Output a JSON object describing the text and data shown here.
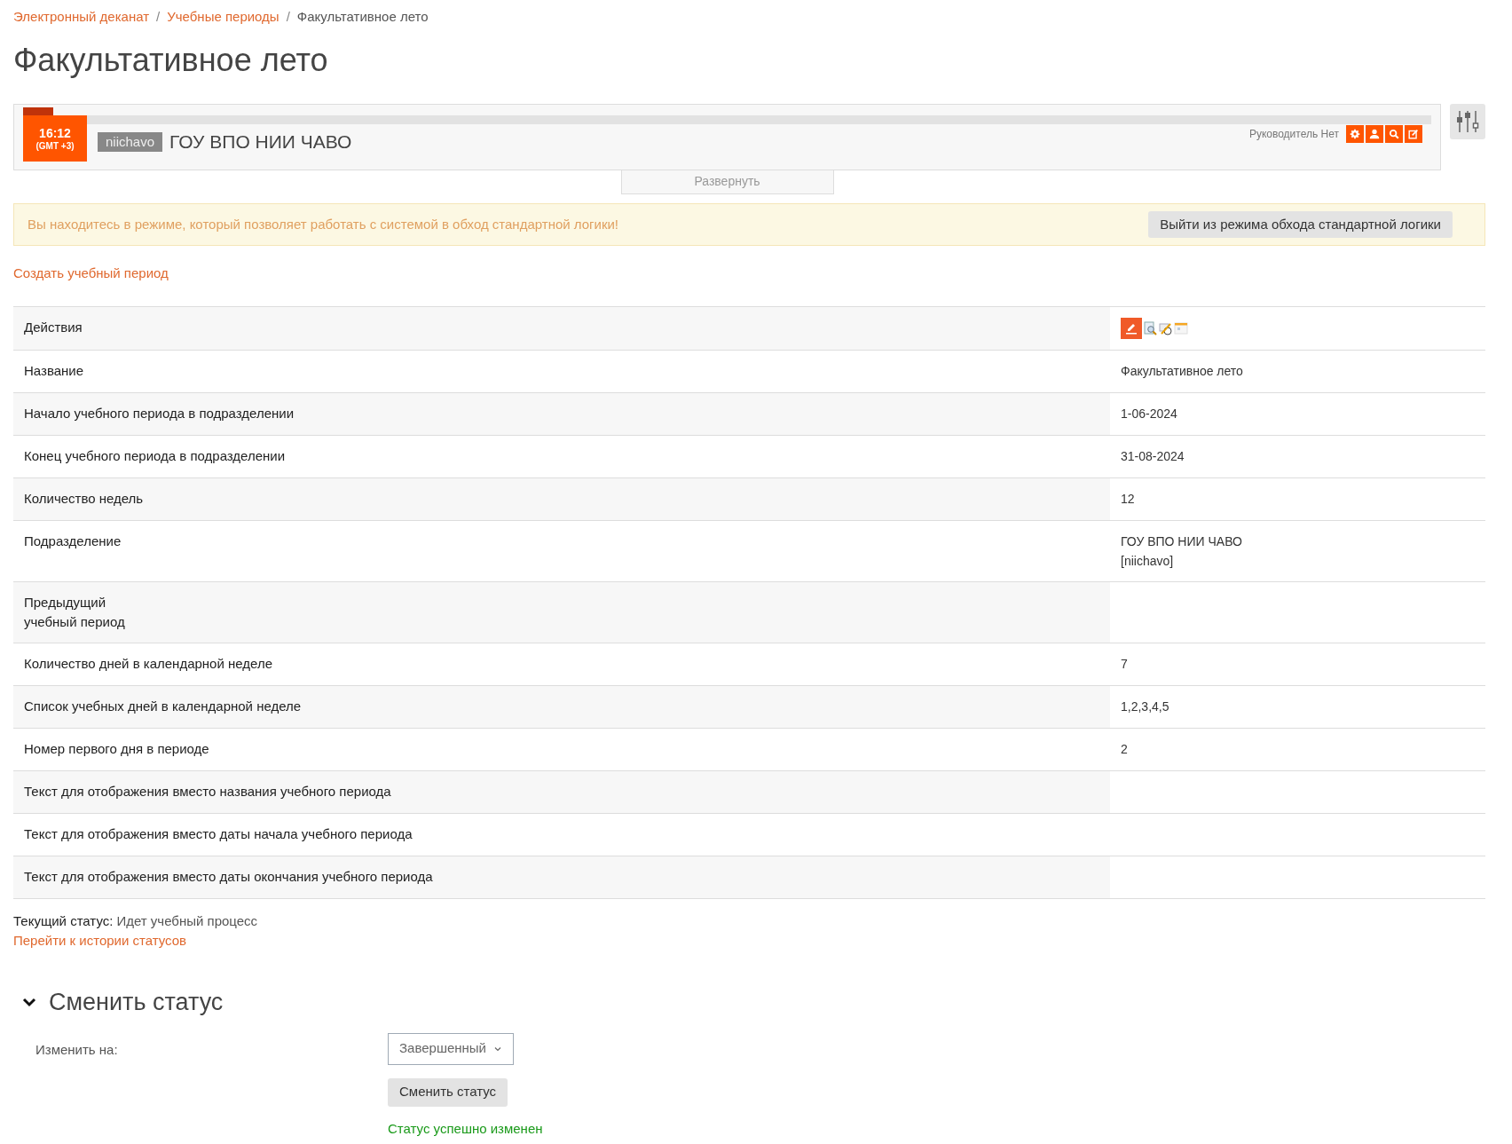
{
  "breadcrumb": [
    {
      "label": "Электронный деканат",
      "current": false
    },
    {
      "separator": "/"
    },
    {
      "label": "Учебные периоды",
      "current": false
    },
    {
      "separator": "/"
    },
    {
      "label": "Факультативное лето",
      "current": true
    }
  ],
  "title": "Факультативное лето",
  "header": {
    "clock_time": "16:12",
    "clock_zone": "(GMT +3)",
    "code": "niichavo",
    "org_name": "ГОУ ВПО НИИ ЧАВО",
    "manager_label": "Руководитель Нет",
    "expand_label": "Развернуть"
  },
  "alert": {
    "text": "Вы находитесь в режиме, который позволяет работать с системой в обход стандартной логики!",
    "button": "Выйти из режима обхода стандартной логики"
  },
  "create_link": "Создать учебный период",
  "table": {
    "rows": [
      {
        "kind": "actions",
        "label": "Действия"
      },
      {
        "kind": "text",
        "label": "Название",
        "value": [
          "Факультативное лето"
        ]
      },
      {
        "kind": "text",
        "label": "Начало учебного периода в подразделении",
        "value": [
          "1-06-2024"
        ]
      },
      {
        "kind": "text",
        "label": "Конец учебного периода в подразделении",
        "value": [
          "31-08-2024"
        ]
      },
      {
        "kind": "text",
        "label": "Количество недель",
        "value": [
          "12"
        ]
      },
      {
        "kind": "text",
        "label": "Подразделение",
        "value": [
          "ГОУ ВПО НИИ ЧАВО",
          "[niichavo]"
        ]
      },
      {
        "kind": "text",
        "label": "Предыдущий\nучебный период"
      },
      {
        "kind": "text",
        "label": "Количество дней в календарной неделе",
        "value": [
          "7"
        ]
      },
      {
        "kind": "text",
        "label": "Список учебных дней в календарной неделе",
        "value": [
          "1,2,3,4,5"
        ]
      },
      {
        "kind": "text",
        "label": "Номер первого дня в периоде",
        "value": [
          "2"
        ]
      },
      {
        "kind": "text",
        "label": "Текст для отображения вместо названия учебного периода"
      },
      {
        "kind": "text",
        "label": "Текст для отображения вместо даты начала учебного периода"
      },
      {
        "kind": "text",
        "label": "Текст для отображения вместо даты окончания учебного периода"
      }
    ]
  },
  "status": {
    "label": "Текущий статус:",
    "value": "Идет учебный процесс",
    "history_link": "Перейти к истории статусов"
  },
  "change_status": {
    "title": "Сменить статус",
    "expanded": true,
    "field_label": "Изменить на:",
    "select_value": "Завершенный",
    "button": "Сменить статус",
    "message": "Статус успешно изменен"
  }
}
